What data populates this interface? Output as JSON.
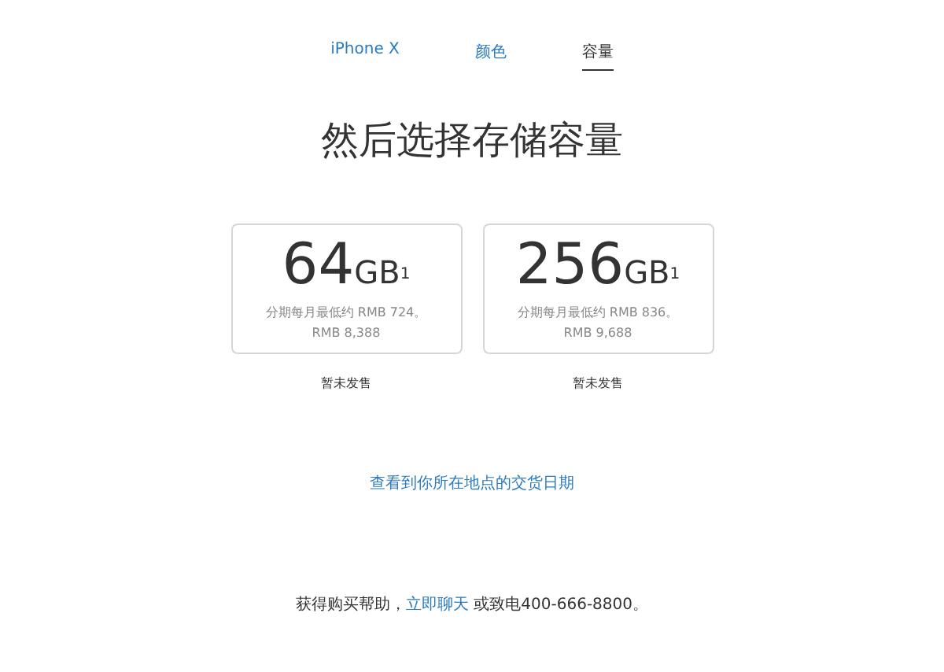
{
  "tabs": [
    {
      "label": "iPhone X",
      "selected": false
    },
    {
      "label": "颜色",
      "selected": false
    },
    {
      "label": "容量",
      "selected": true
    }
  ],
  "title": "然后选择存储容量",
  "options": [
    {
      "capacity": "64",
      "unit": "GB",
      "footnote": "1",
      "installment": "分期每月最低约 RMB 724。",
      "price": "RMB 8,388",
      "status": "暂未发售"
    },
    {
      "capacity": "256",
      "unit": "GB",
      "footnote": "1",
      "installment": "分期每月最低约 RMB 836。",
      "price": "RMB 9,688",
      "status": "暂未发售"
    }
  ],
  "delivery_link": "查看到你所在地点的交货日期",
  "help": {
    "before": "获得购买帮助，",
    "link": "立即聊天",
    "after": " 或致电400-666-8800。"
  }
}
